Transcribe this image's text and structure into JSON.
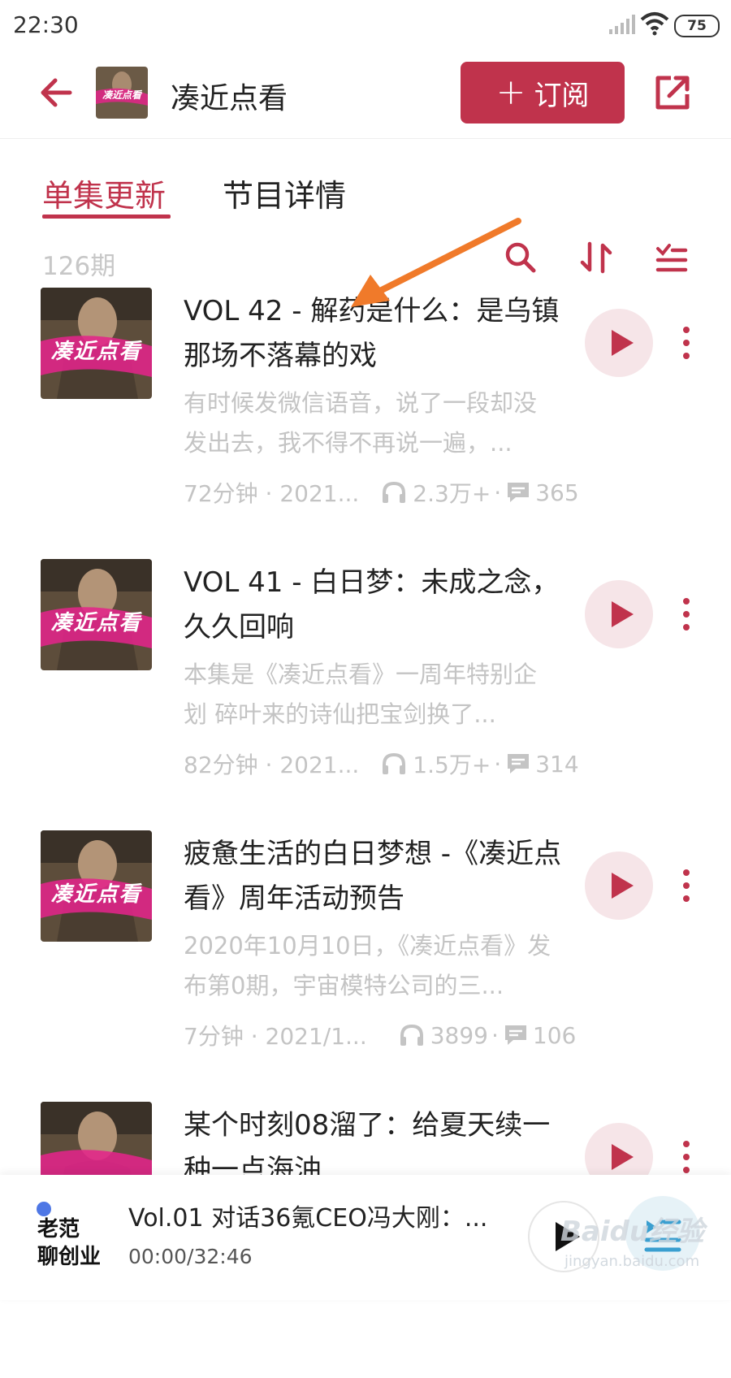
{
  "status_bar": {
    "time": "22:30",
    "battery": "75"
  },
  "header": {
    "title": "凑近点看",
    "subscribe_label": "订阅",
    "thumb_text": "凑近点看"
  },
  "tabs": [
    {
      "label": "单集更新"
    },
    {
      "label": "节目详情"
    }
  ],
  "episode_count": "126期",
  "cover_text": "凑近点看",
  "episodes": [
    {
      "title": "VOL 42 - 解药是什么：是乌镇那场不落幕的戏",
      "description": "有时候发微信语音，说了一段却没发出去，我不得不再说一遍，...",
      "duration_date": "72分钟 · 2021...",
      "plays": "2.3万+",
      "comments": "365"
    },
    {
      "title": "VOL 41 - 白日梦：未成之念，久久回响",
      "description": "本集是《凑近点看》一周年特别企划 碎叶来的诗仙把宝剑换了...",
      "duration_date": "82分钟 · 2021...",
      "plays": "1.5万+",
      "comments": "314"
    },
    {
      "title": "疲惫生活的白日梦想 -《凑近点看》周年活动预告",
      "description": "2020年10月10日，《凑近点看》发布第0期，宇宙模特公司的三...",
      "duration_date": "7分钟 · 2021/1...",
      "plays": "3899",
      "comments": "106"
    },
    {
      "title": "某个时刻08溜了：给夏天续一种一点海油",
      "description": "",
      "duration_date": "",
      "plays": "",
      "comments": ""
    }
  ],
  "player": {
    "logo_line1": "老范",
    "logo_line2": "聊创业",
    "title": "Vol.01 对话36氪CEO冯大刚：...",
    "time": "00:00/32:46"
  },
  "watermark": {
    "text": "Baidu经验",
    "sub": "jingyan.baidu.com"
  },
  "colors": {
    "accent": "#c0334c",
    "muted_text": "#c4c4c4",
    "play_bg": "#f6e5e8",
    "arrow": "#f07a2a"
  }
}
